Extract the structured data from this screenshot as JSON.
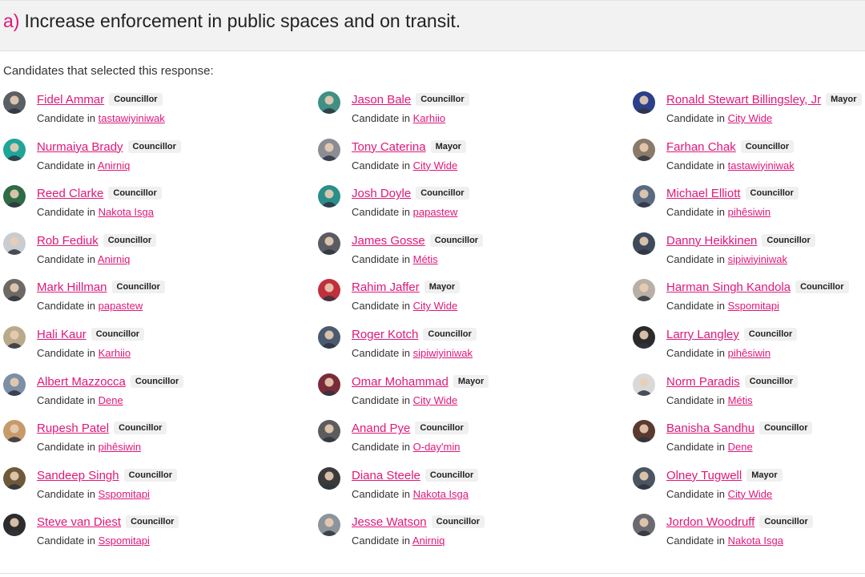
{
  "question": {
    "letter": "a)",
    "text": "Increase enforcement in public spaces and on transit."
  },
  "subtitle": "Candidates that selected this response:",
  "candidate_prefix": "Candidate in",
  "columns": [
    [
      {
        "name": "Fidel Ammar",
        "role": "Councillor",
        "ward": "tastawiyiniwak",
        "avatar_color": "#5a5f66"
      },
      {
        "name": "Nurmaiya Brady",
        "role": "Councillor",
        "ward": "Anirniq",
        "avatar_color": "#1fa59a"
      },
      {
        "name": "Reed Clarke",
        "role": "Councillor",
        "ward": "Nakota Isga",
        "avatar_color": "#2e6b46"
      },
      {
        "name": "Rob Fediuk",
        "role": "Councillor",
        "ward": "Anirniq",
        "avatar_color": "#c9ccd1"
      },
      {
        "name": "Mark Hillman",
        "role": "Councillor",
        "ward": "papastew",
        "avatar_color": "#6d6a66"
      },
      {
        "name": "Hali Kaur",
        "role": "Councillor",
        "ward": "Karhiio",
        "avatar_color": "#b9aa8a"
      },
      {
        "name": "Albert Mazzocca",
        "role": "Councillor",
        "ward": "Dene",
        "avatar_color": "#7b8fa5"
      },
      {
        "name": "Rupesh Patel",
        "role": "Councillor",
        "ward": "pihêsiwin",
        "avatar_color": "#c79a6b"
      },
      {
        "name": "Sandeep Singh",
        "role": "Councillor",
        "ward": "Sspomitapi",
        "avatar_color": "#6e5a3a"
      },
      {
        "name": "Steve van Diest",
        "role": "Councillor",
        "ward": "Sspomitapi",
        "avatar_color": "#2d2d2d"
      }
    ],
    [
      {
        "name": "Jason Bale",
        "role": "Councillor",
        "ward": "Karhiio",
        "avatar_color": "#3f8f86"
      },
      {
        "name": "Tony Caterina",
        "role": "Mayor",
        "ward": "City Wide",
        "avatar_color": "#8a8d93"
      },
      {
        "name": "Josh Doyle",
        "role": "Councillor",
        "ward": "papastew",
        "avatar_color": "#2a8f8a"
      },
      {
        "name": "James Gosse",
        "role": "Councillor",
        "ward": "Métis",
        "avatar_color": "#595c62"
      },
      {
        "name": "Rahim Jaffer",
        "role": "Mayor",
        "ward": "City Wide",
        "avatar_color": "#c0303c"
      },
      {
        "name": "Roger Kotch",
        "role": "Councillor",
        "ward": "sipiwiyiniwak",
        "avatar_color": "#4a5a70"
      },
      {
        "name": "Omar Mohammad",
        "role": "Mayor",
        "ward": "City Wide",
        "avatar_color": "#7a2b3a"
      },
      {
        "name": "Anand Pye",
        "role": "Councillor",
        "ward": "O-day'min",
        "avatar_color": "#5c5c5c"
      },
      {
        "name": "Diana Steele",
        "role": "Councillor",
        "ward": "Nakota Isga",
        "avatar_color": "#3a3a3a"
      },
      {
        "name": "Jesse Watson",
        "role": "Councillor",
        "ward": "Anirniq",
        "avatar_color": "#8c949c"
      }
    ],
    [
      {
        "name": "Ronald Stewart Billingsley, Jr",
        "role": "Mayor",
        "ward": "City Wide",
        "avatar_color": "#2b3f8a"
      },
      {
        "name": "Farhan Chak",
        "role": "Councillor",
        "ward": "tastawiyiniwak",
        "avatar_color": "#8a7a6a"
      },
      {
        "name": "Michael Elliott",
        "role": "Councillor",
        "ward": "pihêsiwin",
        "avatar_color": "#5a6a80"
      },
      {
        "name": "Danny Heikkinen",
        "role": "Councillor",
        "ward": "sipiwiyiniwak",
        "avatar_color": "#3d4a5a"
      },
      {
        "name": "Harman Singh Kandola",
        "role": "Councillor",
        "ward": "Sspomitapi",
        "avatar_color": "#b8b0a6"
      },
      {
        "name": "Larry Langley",
        "role": "Councillor",
        "ward": "pihêsiwin",
        "avatar_color": "#2a2a2a"
      },
      {
        "name": "Norm Paradis",
        "role": "Councillor",
        "ward": "Métis",
        "avatar_color": "#d9d9d9"
      },
      {
        "name": "Banisha Sandhu",
        "role": "Councillor",
        "ward": "Dene",
        "avatar_color": "#5a3a30"
      },
      {
        "name": "Olney Tugwell",
        "role": "Mayor",
        "ward": "City Wide",
        "avatar_color": "#4a5560"
      },
      {
        "name": "Jordon Woodruff",
        "role": "Councillor",
        "ward": "Nakota Isga",
        "avatar_color": "#6a6a70"
      }
    ]
  ]
}
